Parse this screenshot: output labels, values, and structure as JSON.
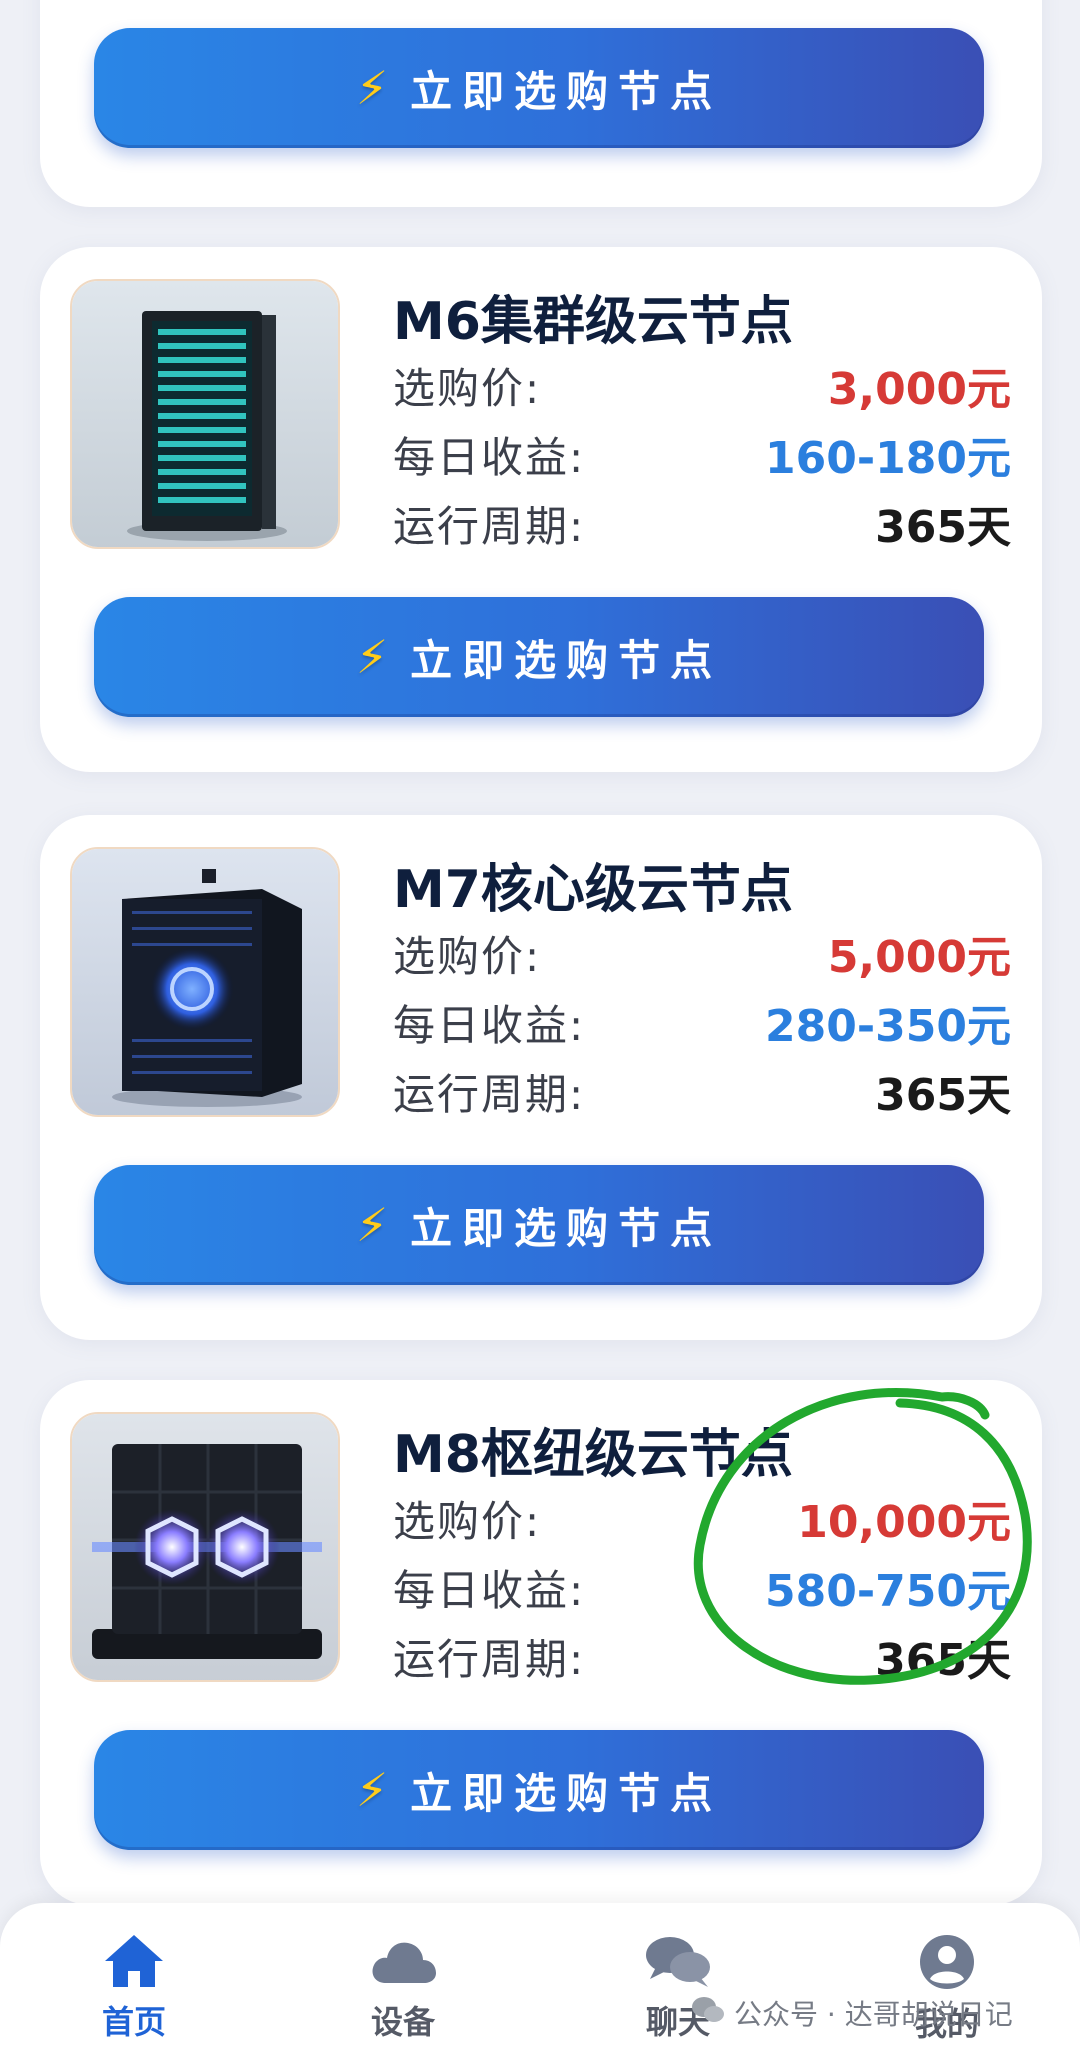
{
  "buy_button_label": "立即选购节点",
  "labels": {
    "price": "选购价:",
    "daily_income": "每日收益:",
    "cycle": "运行周期:"
  },
  "nodes": [
    {
      "title": "M6集群级云节点",
      "price": "3,000元",
      "daily_income": "160-180元",
      "cycle": "365天"
    },
    {
      "title": "M7核心级云节点",
      "price": "5,000元",
      "daily_income": "280-350元",
      "cycle": "365天"
    },
    {
      "title": "M8枢纽级云节点",
      "price": "10,000元",
      "daily_income": "580-750元",
      "cycle": "365天"
    }
  ],
  "nav": {
    "home": "首页",
    "device": "设备",
    "chat": "聊天",
    "me": "我的"
  },
  "watermark": "公众号 · 达哥胡说日记",
  "icons": {
    "buy": "lightning-bolt-icon",
    "home": "home-icon",
    "device": "cloud-icon",
    "chat": "chat-bubbles-icon",
    "me": "user-avatar-icon",
    "watermark": "wechat-icon"
  },
  "colors": {
    "accent": "#2f6fd9",
    "price": "#d63a36",
    "income": "#2b7fde",
    "annotation": "#22a82e"
  }
}
